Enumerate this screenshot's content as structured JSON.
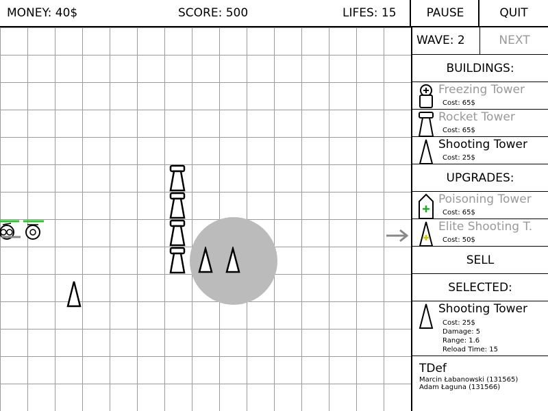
{
  "topbar": {
    "money": "MONEY: 40$",
    "score": "SCORE: 500",
    "lives": "LIFES: 15"
  },
  "buttons": {
    "pause": "PAUSE",
    "quit": "QUIT",
    "next": "NEXT"
  },
  "wave": "WAVE: 2",
  "buildings": {
    "header": "BUILDINGS:",
    "items": [
      {
        "name": "Freezing Tower",
        "cost": "Cost: 65$",
        "icon": "freezing-tower-icon",
        "available": false
      },
      {
        "name": "Rocket Tower",
        "cost": "Cost: 65$",
        "icon": "rocket-tower-icon",
        "available": false
      },
      {
        "name": "Shooting Tower",
        "cost": "Cost: 25$",
        "icon": "shooting-tower-icon",
        "available": true
      }
    ]
  },
  "upgrades": {
    "header": "UPGRADES:",
    "items": [
      {
        "name": "Poisoning Tower",
        "cost": "Cost: 65$",
        "icon": "poisoning-tower-icon",
        "available": false
      },
      {
        "name": "Elite Shooting T.",
        "cost": "Cost: 50$",
        "icon": "elite-shooting-tower-icon",
        "available": false
      }
    ]
  },
  "sell": "SELL",
  "selected": {
    "header": "SELECTED:",
    "name": "Shooting Tower",
    "cost": "Cost: 25$",
    "damage": "Damage: 5",
    "range": "Range: 1.6",
    "reload": "Reload Time: 15"
  },
  "credits": {
    "title": "TDef",
    "authors": [
      "Marcin Łabanowski (131565)",
      "Adam Łaguna (131566)"
    ]
  },
  "colors": {
    "grid": "#999999",
    "range": "#bbbbbb",
    "health": "#22cc22",
    "disabled": "#999999"
  }
}
